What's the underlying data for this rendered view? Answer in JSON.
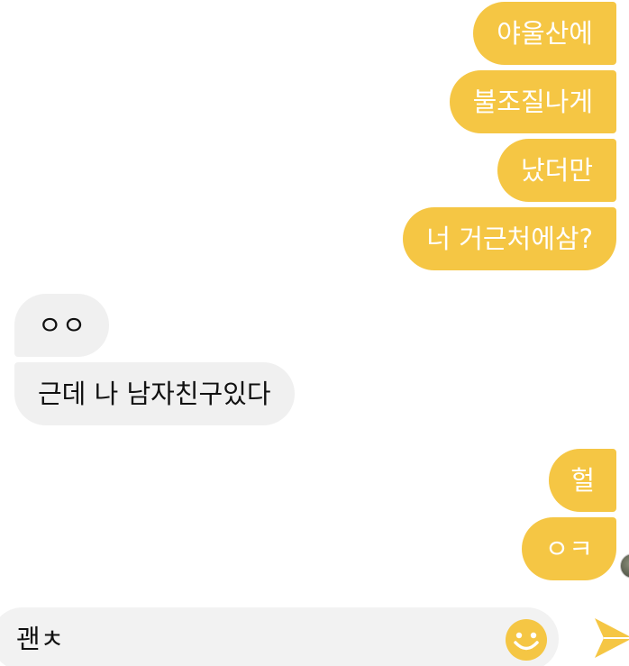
{
  "messages": [
    {
      "direction": "out",
      "text": "야울산에"
    },
    {
      "direction": "out",
      "text": "불조질나게"
    },
    {
      "direction": "out",
      "text": "났더만"
    },
    {
      "direction": "out",
      "text": "너 거근처에삼?"
    },
    {
      "direction": "in",
      "text": "ㅇㅇ"
    },
    {
      "direction": "in",
      "text": "근데 나 남자친구있다"
    },
    {
      "direction": "out",
      "text": "헐"
    },
    {
      "direction": "out",
      "text": "ㅇㅋ"
    }
  ],
  "composer": {
    "value": "괜ㅊ",
    "emoji_icon": "smiley-face-icon",
    "send_icon": "paper-plane-send-icon"
  },
  "colors": {
    "outgoing_bubble": "#f5c644",
    "incoming_bubble": "#f0f0f0",
    "accent": "#f5c644"
  }
}
